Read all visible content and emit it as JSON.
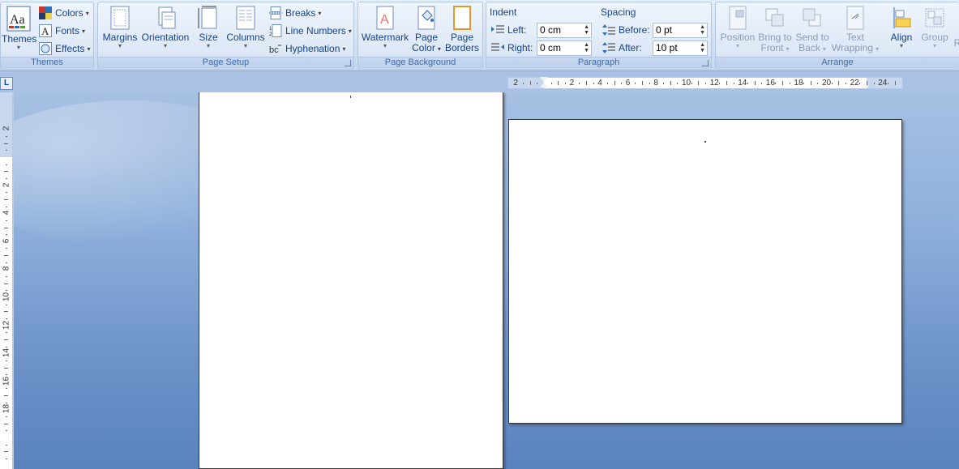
{
  "ribbon": {
    "themes_group": {
      "label": "Themes",
      "themes_button": "Themes",
      "colors": "Colors",
      "fonts": "Fonts",
      "effects": "Effects"
    },
    "page_setup_group": {
      "label": "Page Setup",
      "margins": "Margins",
      "orientation": "Orientation",
      "size": "Size",
      "columns": "Columns",
      "breaks": "Breaks",
      "line_numbers": "Line Numbers",
      "hyphenation": "Hyphenation"
    },
    "page_background_group": {
      "label": "Page Background",
      "watermark": "Watermark",
      "page_color_line1": "Page",
      "page_color_line2": "Color",
      "page_borders_line1": "Page",
      "page_borders_line2": "Borders"
    },
    "paragraph_group": {
      "label": "Paragraph",
      "indent_heading": "Indent",
      "spacing_heading": "Spacing",
      "left_label": "Left:",
      "left_value": "0 cm",
      "right_label": "Right:",
      "right_value": "0 cm",
      "before_label": "Before:",
      "before_value": "0 pt",
      "after_label": "After:",
      "after_value": "10 pt"
    },
    "arrange_group": {
      "label": "Arrange",
      "position": "Position",
      "bring_to_front_line1": "Bring to",
      "bring_to_front_line2": "Front",
      "send_to_back_line1": "Send to",
      "send_to_back_line2": "Back",
      "text_wrapping_line1": "Text",
      "text_wrapping_line2": "Wrapping",
      "align": "Align",
      "group": "Group",
      "rotate_partial": "R"
    }
  },
  "ruler": {
    "corner": "L",
    "h_labels": [
      "2",
      "2",
      "4",
      "6",
      "8",
      "10",
      "12",
      "14",
      "16",
      "18",
      "20",
      "22",
      "24"
    ],
    "v_labels": [
      "2",
      "2",
      "4",
      "6",
      "8",
      "10",
      "12",
      "14",
      "16",
      "18"
    ]
  }
}
